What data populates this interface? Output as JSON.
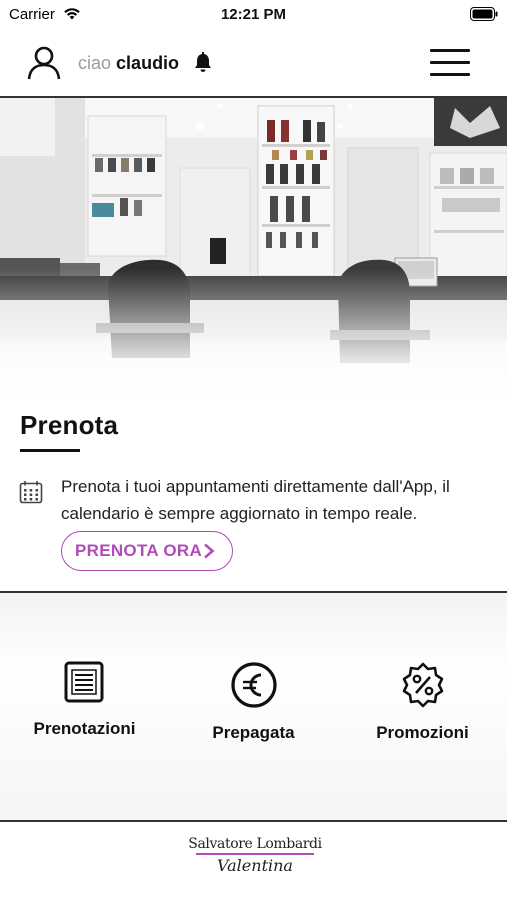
{
  "status_bar": {
    "carrier": "Carrier",
    "time": "12:21 PM"
  },
  "header": {
    "greeting_prefix": "ciao",
    "user_name": "claudio",
    "icons": {
      "avatar": "person-icon",
      "notifications": "bell-icon",
      "menu": "hamburger-menu-icon"
    }
  },
  "booking": {
    "title": "Prenota",
    "description": "Prenota i tuoi appuntamenti direttamente dall'App, il calendario è sempre aggiornato in tempo reale.",
    "button_label": "PRENOTA ORA",
    "icon": "calendar-icon"
  },
  "actions": [
    {
      "label": "Prenotazioni",
      "icon": "document-list-icon"
    },
    {
      "label": "Prepagata",
      "icon": "euro-icon"
    },
    {
      "label": "Promozioni",
      "icon": "percent-badge-icon"
    }
  ],
  "footer": {
    "logo_line1": "Salvatore Lombardi",
    "logo_line2": "Valentina"
  },
  "colors": {
    "accent": "#b14bb8",
    "text": "#111111",
    "divider": "#333333"
  }
}
